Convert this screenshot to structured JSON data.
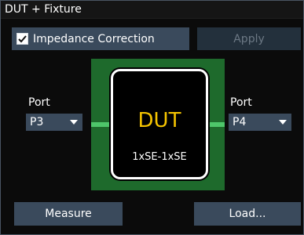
{
  "window": {
    "title": "DUT + Fixture"
  },
  "impedance_correction": {
    "label": "Impedance Correction",
    "checked": true
  },
  "apply_button": {
    "label": "Apply",
    "enabled": false
  },
  "port_left": {
    "label": "Port",
    "value": "P3"
  },
  "port_right": {
    "label": "Port",
    "value": "P4"
  },
  "dut": {
    "name": "DUT",
    "config": "1xSE-1xSE"
  },
  "measure_button": {
    "label": "Measure"
  },
  "load_button": {
    "label": "Load..."
  },
  "colors": {
    "background": "#0b0b0b",
    "button": "#3a4a5c",
    "button_disabled": "#23303c",
    "fixture_green": "#1e6a2c",
    "lead_green": "#4ec66a",
    "dut_text": "#f5c400"
  }
}
